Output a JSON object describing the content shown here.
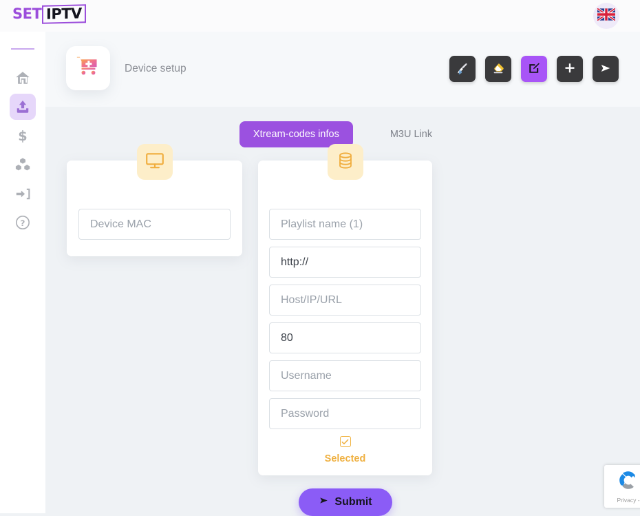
{
  "brand": {
    "logo_set": "SET",
    "logo_iptv": "IPTV",
    "accent_purple": "#9b51e0",
    "accent_orange": "#efb040",
    "page_bg": "#eff2f5"
  },
  "topbar": {
    "language_icon": "uk-flag-icon",
    "language_label": "English"
  },
  "sidebar": {
    "items": [
      {
        "icon": "home-icon",
        "label": "Home",
        "active": false
      },
      {
        "icon": "upload-icon",
        "label": "Upload",
        "active": true
      },
      {
        "icon": "dollar-icon",
        "label": "Billing",
        "active": false
      },
      {
        "icon": "boxes-icon",
        "label": "Packages",
        "active": false
      },
      {
        "icon": "sign-in-icon",
        "label": "Login",
        "active": false
      },
      {
        "icon": "question-circle-icon",
        "label": "Help",
        "active": false
      }
    ]
  },
  "header": {
    "icon": "cart-plus-icon",
    "title": "Device setup",
    "toolbar": [
      {
        "icon": "paintbrush-icon",
        "label": "Brush",
        "active": false
      },
      {
        "icon": "eraser-icon",
        "label": "Eraser",
        "active": false
      },
      {
        "icon": "edit-square-icon",
        "label": "Edit",
        "active": true
      },
      {
        "icon": "plus-icon",
        "label": "Add",
        "active": false
      },
      {
        "icon": "send-icon",
        "label": "Send",
        "active": false
      }
    ]
  },
  "tabs": [
    {
      "label": "Xtream-codes infos",
      "active": true
    },
    {
      "label": "M3U Link",
      "active": false
    }
  ],
  "mac_card": {
    "icon": "tv-monitor-icon",
    "mac_field": {
      "value": "",
      "placeholder": "Device MAC"
    }
  },
  "xtream_card": {
    "icon": "database-icon",
    "fields": [
      {
        "name": "playlist-name-input",
        "value": "",
        "placeholder": "Playlist name (1)"
      },
      {
        "name": "protocol-input",
        "value": "http://",
        "placeholder": "http://"
      },
      {
        "name": "host-input",
        "value": "",
        "placeholder": "Host/IP/URL"
      },
      {
        "name": "port-input",
        "value": "80",
        "placeholder": "80"
      },
      {
        "name": "username-input",
        "value": "",
        "placeholder": "Username"
      },
      {
        "name": "password-input",
        "value": "",
        "placeholder": "Password"
      }
    ],
    "selected": {
      "checked": true,
      "label": "Selected"
    }
  },
  "submit": {
    "label": "Submit",
    "icon": "send-icon"
  },
  "recaptcha": {
    "icon": "recaptcha-icon",
    "privacy_text": "Privacy -"
  }
}
